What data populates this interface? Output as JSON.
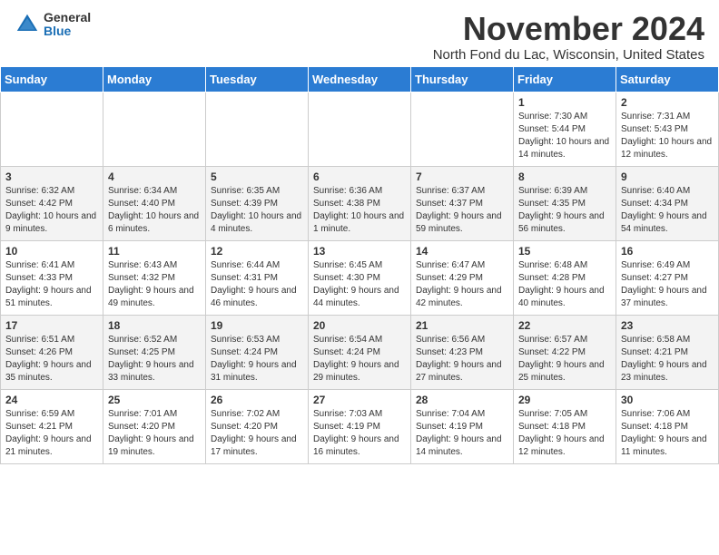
{
  "header": {
    "logo_general": "General",
    "logo_blue": "Blue",
    "month_title": "November 2024",
    "subtitle": "North Fond du Lac, Wisconsin, United States"
  },
  "days_of_week": [
    "Sunday",
    "Monday",
    "Tuesday",
    "Wednesday",
    "Thursday",
    "Friday",
    "Saturday"
  ],
  "weeks": [
    [
      {
        "day": "",
        "info": ""
      },
      {
        "day": "",
        "info": ""
      },
      {
        "day": "",
        "info": ""
      },
      {
        "day": "",
        "info": ""
      },
      {
        "day": "",
        "info": ""
      },
      {
        "day": "1",
        "info": "Sunrise: 7:30 AM\nSunset: 5:44 PM\nDaylight: 10 hours and 14 minutes."
      },
      {
        "day": "2",
        "info": "Sunrise: 7:31 AM\nSunset: 5:43 PM\nDaylight: 10 hours and 12 minutes."
      }
    ],
    [
      {
        "day": "3",
        "info": "Sunrise: 6:32 AM\nSunset: 4:42 PM\nDaylight: 10 hours and 9 minutes."
      },
      {
        "day": "4",
        "info": "Sunrise: 6:34 AM\nSunset: 4:40 PM\nDaylight: 10 hours and 6 minutes."
      },
      {
        "day": "5",
        "info": "Sunrise: 6:35 AM\nSunset: 4:39 PM\nDaylight: 10 hours and 4 minutes."
      },
      {
        "day": "6",
        "info": "Sunrise: 6:36 AM\nSunset: 4:38 PM\nDaylight: 10 hours and 1 minute."
      },
      {
        "day": "7",
        "info": "Sunrise: 6:37 AM\nSunset: 4:37 PM\nDaylight: 9 hours and 59 minutes."
      },
      {
        "day": "8",
        "info": "Sunrise: 6:39 AM\nSunset: 4:35 PM\nDaylight: 9 hours and 56 minutes."
      },
      {
        "day": "9",
        "info": "Sunrise: 6:40 AM\nSunset: 4:34 PM\nDaylight: 9 hours and 54 minutes."
      }
    ],
    [
      {
        "day": "10",
        "info": "Sunrise: 6:41 AM\nSunset: 4:33 PM\nDaylight: 9 hours and 51 minutes."
      },
      {
        "day": "11",
        "info": "Sunrise: 6:43 AM\nSunset: 4:32 PM\nDaylight: 9 hours and 49 minutes."
      },
      {
        "day": "12",
        "info": "Sunrise: 6:44 AM\nSunset: 4:31 PM\nDaylight: 9 hours and 46 minutes."
      },
      {
        "day": "13",
        "info": "Sunrise: 6:45 AM\nSunset: 4:30 PM\nDaylight: 9 hours and 44 minutes."
      },
      {
        "day": "14",
        "info": "Sunrise: 6:47 AM\nSunset: 4:29 PM\nDaylight: 9 hours and 42 minutes."
      },
      {
        "day": "15",
        "info": "Sunrise: 6:48 AM\nSunset: 4:28 PM\nDaylight: 9 hours and 40 minutes."
      },
      {
        "day": "16",
        "info": "Sunrise: 6:49 AM\nSunset: 4:27 PM\nDaylight: 9 hours and 37 minutes."
      }
    ],
    [
      {
        "day": "17",
        "info": "Sunrise: 6:51 AM\nSunset: 4:26 PM\nDaylight: 9 hours and 35 minutes."
      },
      {
        "day": "18",
        "info": "Sunrise: 6:52 AM\nSunset: 4:25 PM\nDaylight: 9 hours and 33 minutes."
      },
      {
        "day": "19",
        "info": "Sunrise: 6:53 AM\nSunset: 4:24 PM\nDaylight: 9 hours and 31 minutes."
      },
      {
        "day": "20",
        "info": "Sunrise: 6:54 AM\nSunset: 4:24 PM\nDaylight: 9 hours and 29 minutes."
      },
      {
        "day": "21",
        "info": "Sunrise: 6:56 AM\nSunset: 4:23 PM\nDaylight: 9 hours and 27 minutes."
      },
      {
        "day": "22",
        "info": "Sunrise: 6:57 AM\nSunset: 4:22 PM\nDaylight: 9 hours and 25 minutes."
      },
      {
        "day": "23",
        "info": "Sunrise: 6:58 AM\nSunset: 4:21 PM\nDaylight: 9 hours and 23 minutes."
      }
    ],
    [
      {
        "day": "24",
        "info": "Sunrise: 6:59 AM\nSunset: 4:21 PM\nDaylight: 9 hours and 21 minutes."
      },
      {
        "day": "25",
        "info": "Sunrise: 7:01 AM\nSunset: 4:20 PM\nDaylight: 9 hours and 19 minutes."
      },
      {
        "day": "26",
        "info": "Sunrise: 7:02 AM\nSunset: 4:20 PM\nDaylight: 9 hours and 17 minutes."
      },
      {
        "day": "27",
        "info": "Sunrise: 7:03 AM\nSunset: 4:19 PM\nDaylight: 9 hours and 16 minutes."
      },
      {
        "day": "28",
        "info": "Sunrise: 7:04 AM\nSunset: 4:19 PM\nDaylight: 9 hours and 14 minutes."
      },
      {
        "day": "29",
        "info": "Sunrise: 7:05 AM\nSunset: 4:18 PM\nDaylight: 9 hours and 12 minutes."
      },
      {
        "day": "30",
        "info": "Sunrise: 7:06 AM\nSunset: 4:18 PM\nDaylight: 9 hours and 11 minutes."
      }
    ]
  ]
}
